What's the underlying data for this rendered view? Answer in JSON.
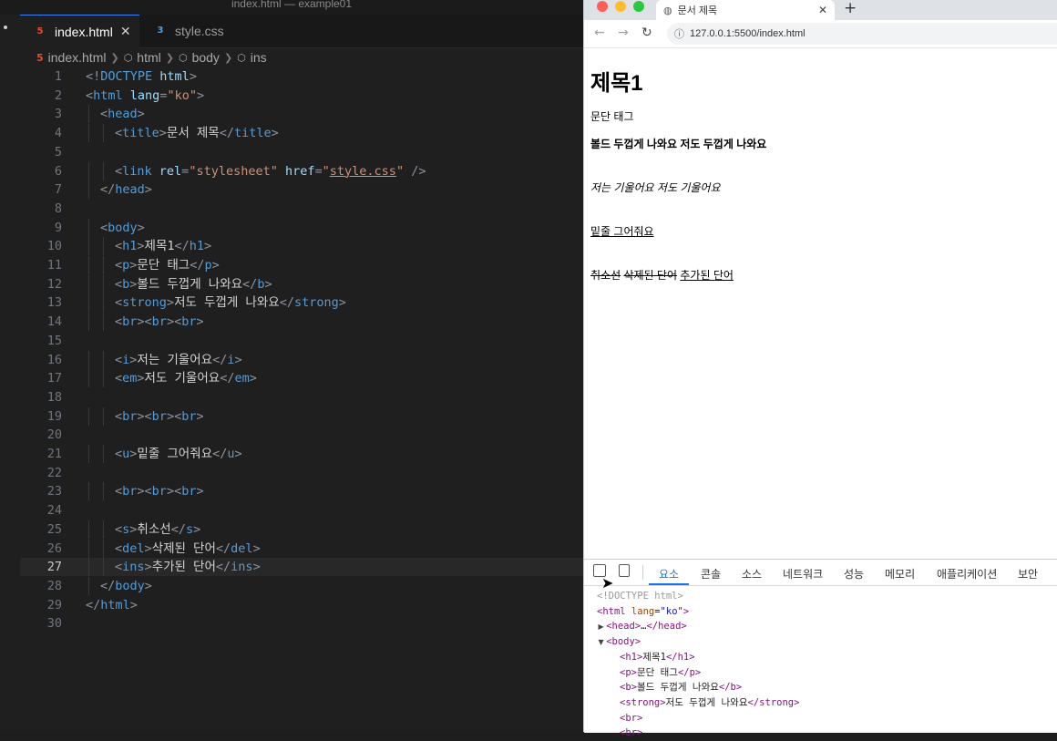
{
  "window": {
    "title": "index.html — example01"
  },
  "editor": {
    "tabs": [
      {
        "label": "index.html",
        "icon": "html5-icon",
        "active": true
      },
      {
        "label": "style.css",
        "icon": "css3-icon",
        "active": false
      }
    ],
    "breadcrumb": [
      "index.html",
      "html",
      "body",
      "ins"
    ],
    "current_line": 27,
    "line_numbers": [
      "1",
      "2",
      "3",
      "4",
      "5",
      "6",
      "7",
      "8",
      "9",
      "10",
      "11",
      "12",
      "13",
      "14",
      "15",
      "16",
      "17",
      "18",
      "19",
      "20",
      "21",
      "22",
      "23",
      "24",
      "25",
      "26",
      "27",
      "28",
      "29",
      "30"
    ],
    "lines": [
      {
        "indent": 0,
        "tokens": [
          [
            "t",
            "<!"
          ],
          [
            "d",
            "DOCTYPE"
          ],
          [
            "a",
            " html"
          ],
          [
            "t",
            ">"
          ]
        ]
      },
      {
        "indent": 0,
        "tokens": [
          [
            "t",
            "<"
          ],
          [
            "n",
            "html"
          ],
          [
            "a",
            " lang"
          ],
          [
            "t",
            "="
          ],
          [
            "s",
            "\"ko\""
          ],
          [
            "t",
            ">"
          ]
        ]
      },
      {
        "indent": 1,
        "tokens": [
          [
            "t",
            "<"
          ],
          [
            "n",
            "head"
          ],
          [
            "t",
            ">"
          ]
        ]
      },
      {
        "indent": 2,
        "tokens": [
          [
            "t",
            "<"
          ],
          [
            "n",
            "title"
          ],
          [
            "t",
            ">"
          ],
          [
            "x",
            "문서 제목"
          ],
          [
            "t",
            "</"
          ],
          [
            "n",
            "title"
          ],
          [
            "t",
            ">"
          ]
        ]
      },
      {
        "indent": 0,
        "tokens": []
      },
      {
        "indent": 2,
        "tokens": [
          [
            "t",
            "<"
          ],
          [
            "n",
            "link"
          ],
          [
            "a",
            " rel"
          ],
          [
            "t",
            "="
          ],
          [
            "s",
            "\"stylesheet\""
          ],
          [
            "a",
            " href"
          ],
          [
            "t",
            "="
          ],
          [
            "s",
            "\""
          ],
          [
            "l",
            "style.css"
          ],
          [
            "s",
            "\""
          ],
          [
            "t",
            " />"
          ]
        ]
      },
      {
        "indent": 1,
        "tokens": [
          [
            "t",
            "</"
          ],
          [
            "n",
            "head"
          ],
          [
            "t",
            ">"
          ]
        ]
      },
      {
        "indent": 0,
        "tokens": []
      },
      {
        "indent": 1,
        "tokens": [
          [
            "t",
            "<"
          ],
          [
            "n",
            "body"
          ],
          [
            "t",
            ">"
          ]
        ]
      },
      {
        "indent": 2,
        "tokens": [
          [
            "t",
            "<"
          ],
          [
            "n",
            "h1"
          ],
          [
            "t",
            ">"
          ],
          [
            "x",
            "제목1"
          ],
          [
            "t",
            "</"
          ],
          [
            "n",
            "h1"
          ],
          [
            "t",
            ">"
          ]
        ]
      },
      {
        "indent": 2,
        "tokens": [
          [
            "t",
            "<"
          ],
          [
            "n",
            "p"
          ],
          [
            "t",
            ">"
          ],
          [
            "x",
            "문단 태그"
          ],
          [
            "t",
            "</"
          ],
          [
            "n",
            "p"
          ],
          [
            "t",
            ">"
          ]
        ]
      },
      {
        "indent": 2,
        "tokens": [
          [
            "t",
            "<"
          ],
          [
            "n",
            "b"
          ],
          [
            "t",
            ">"
          ],
          [
            "x",
            "볼드 두껍게 나와요"
          ],
          [
            "t",
            "</"
          ],
          [
            "n",
            "b"
          ],
          [
            "t",
            ">"
          ]
        ]
      },
      {
        "indent": 2,
        "tokens": [
          [
            "t",
            "<"
          ],
          [
            "n",
            "strong"
          ],
          [
            "t",
            ">"
          ],
          [
            "x",
            "저도 두껍게 나와요"
          ],
          [
            "t",
            "</"
          ],
          [
            "n",
            "strong"
          ],
          [
            "t",
            ">"
          ]
        ]
      },
      {
        "indent": 2,
        "tokens": [
          [
            "t",
            "<"
          ],
          [
            "n",
            "br"
          ],
          [
            "t",
            "><"
          ],
          [
            "n",
            "br"
          ],
          [
            "t",
            "><"
          ],
          [
            "n",
            "br"
          ],
          [
            "t",
            ">"
          ]
        ]
      },
      {
        "indent": 0,
        "tokens": []
      },
      {
        "indent": 2,
        "tokens": [
          [
            "t",
            "<"
          ],
          [
            "n",
            "i"
          ],
          [
            "t",
            ">"
          ],
          [
            "x",
            "저는 기울어요"
          ],
          [
            "t",
            "</"
          ],
          [
            "n",
            "i"
          ],
          [
            "t",
            ">"
          ]
        ]
      },
      {
        "indent": 2,
        "tokens": [
          [
            "t",
            "<"
          ],
          [
            "n",
            "em"
          ],
          [
            "t",
            ">"
          ],
          [
            "x",
            "저도 기울어요"
          ],
          [
            "t",
            "</"
          ],
          [
            "n",
            "em"
          ],
          [
            "t",
            ">"
          ]
        ]
      },
      {
        "indent": 0,
        "tokens": []
      },
      {
        "indent": 2,
        "tokens": [
          [
            "t",
            "<"
          ],
          [
            "n",
            "br"
          ],
          [
            "t",
            "><"
          ],
          [
            "n",
            "br"
          ],
          [
            "t",
            "><"
          ],
          [
            "n",
            "br"
          ],
          [
            "t",
            ">"
          ]
        ]
      },
      {
        "indent": 0,
        "tokens": []
      },
      {
        "indent": 2,
        "tokens": [
          [
            "t",
            "<"
          ],
          [
            "n",
            "u"
          ],
          [
            "t",
            ">"
          ],
          [
            "x",
            "밑줄 그어줘요"
          ],
          [
            "t",
            "</"
          ],
          [
            "n",
            "u"
          ],
          [
            "t",
            ">"
          ]
        ]
      },
      {
        "indent": 0,
        "tokens": []
      },
      {
        "indent": 2,
        "tokens": [
          [
            "t",
            "<"
          ],
          [
            "n",
            "br"
          ],
          [
            "t",
            "><"
          ],
          [
            "n",
            "br"
          ],
          [
            "t",
            "><"
          ],
          [
            "n",
            "br"
          ],
          [
            "t",
            ">"
          ]
        ]
      },
      {
        "indent": 0,
        "tokens": []
      },
      {
        "indent": 2,
        "tokens": [
          [
            "t",
            "<"
          ],
          [
            "n",
            "s"
          ],
          [
            "t",
            ">"
          ],
          [
            "x",
            "취소선"
          ],
          [
            "t",
            "</"
          ],
          [
            "n",
            "s"
          ],
          [
            "t",
            ">"
          ]
        ]
      },
      {
        "indent": 2,
        "tokens": [
          [
            "t",
            "<"
          ],
          [
            "n",
            "del"
          ],
          [
            "t",
            ">"
          ],
          [
            "x",
            "삭제된 단어"
          ],
          [
            "t",
            "</"
          ],
          [
            "n",
            "del"
          ],
          [
            "t",
            ">"
          ]
        ]
      },
      {
        "indent": 2,
        "tokens": [
          [
            "t",
            "<"
          ],
          [
            "n",
            "ins"
          ],
          [
            "t",
            ">"
          ],
          [
            "x",
            "추가된 단어"
          ],
          [
            "t",
            "</"
          ],
          [
            "n",
            "ins"
          ],
          [
            "t",
            ">"
          ]
        ]
      },
      {
        "indent": 1,
        "tokens": [
          [
            "t",
            "</"
          ],
          [
            "n",
            "body"
          ],
          [
            "t",
            ">"
          ]
        ]
      },
      {
        "indent": 0,
        "tokens": [
          [
            "t",
            "</"
          ],
          [
            "n",
            "html"
          ],
          [
            "t",
            ">"
          ]
        ]
      },
      {
        "indent": 0,
        "tokens": []
      }
    ]
  },
  "browser": {
    "tab_title": "문서 제목",
    "new_tab": "+",
    "url": "127.0.0.1:5500/index.html",
    "page": {
      "h1": "제목1",
      "p": "문단 태그",
      "bold": "볼드 두껍게 나와요",
      "strong": "저도 두껍게 나와요",
      "italic": "저는 기울어요",
      "em": "저도 기울어요",
      "underline": "밑줄 그어줘요",
      "strike": "취소선",
      "del": "삭제된 단어",
      "ins": "추가된 단어"
    },
    "devtools": {
      "tabs": [
        "요소",
        "콘솔",
        "소스",
        "네트워크",
        "성능",
        "메모리",
        "애플리케이션",
        "보안"
      ],
      "active_tab": "요소",
      "dom": [
        {
          "indent": 0,
          "tri": "",
          "parts": [
            [
              "dt",
              "<!DOCTYPE html>"
            ]
          ]
        },
        {
          "indent": 0,
          "tri": "",
          "parts": [
            [
              "tg",
              "<html"
            ],
            [
              "at",
              " lang"
            ],
            [
              "tx",
              "="
            ],
            [
              "vl",
              "\"ko\""
            ],
            [
              "tg",
              ">"
            ]
          ]
        },
        {
          "indent": 1,
          "tri": "▶",
          "parts": [
            [
              "tg",
              "<head>"
            ],
            [
              "tx",
              "…"
            ],
            [
              "tg",
              "</head>"
            ]
          ]
        },
        {
          "indent": 1,
          "tri": "▼",
          "parts": [
            [
              "tg",
              "<body>"
            ]
          ]
        },
        {
          "indent": 2,
          "tri": "",
          "parts": [
            [
              "tg",
              "<h1>"
            ],
            [
              "tx",
              "제목1"
            ],
            [
              "tg",
              "</h1>"
            ]
          ]
        },
        {
          "indent": 2,
          "tri": "",
          "parts": [
            [
              "tg",
              "<p>"
            ],
            [
              "tx",
              "문단 태그"
            ],
            [
              "tg",
              "</p>"
            ]
          ]
        },
        {
          "indent": 2,
          "tri": "",
          "parts": [
            [
              "tg",
              "<b>"
            ],
            [
              "tx",
              "볼드 두껍게 나와요"
            ],
            [
              "tg",
              "</b>"
            ]
          ]
        },
        {
          "indent": 2,
          "tri": "",
          "parts": [
            [
              "tg",
              "<strong>"
            ],
            [
              "tx",
              "저도 두껍게 나와요"
            ],
            [
              "tg",
              "</strong>"
            ]
          ]
        },
        {
          "indent": 2,
          "tri": "",
          "parts": [
            [
              "tg",
              "<br>"
            ]
          ]
        },
        {
          "indent": 2,
          "tri": "",
          "parts": [
            [
              "tg",
              "<br>"
            ]
          ]
        }
      ]
    }
  },
  "colors": {
    "editor_bg": "#1f1f1f",
    "tag_name": "#569cd6",
    "attr": "#9cdcfe",
    "string": "#ce9178",
    "devtools_active": "#1a73e8"
  }
}
